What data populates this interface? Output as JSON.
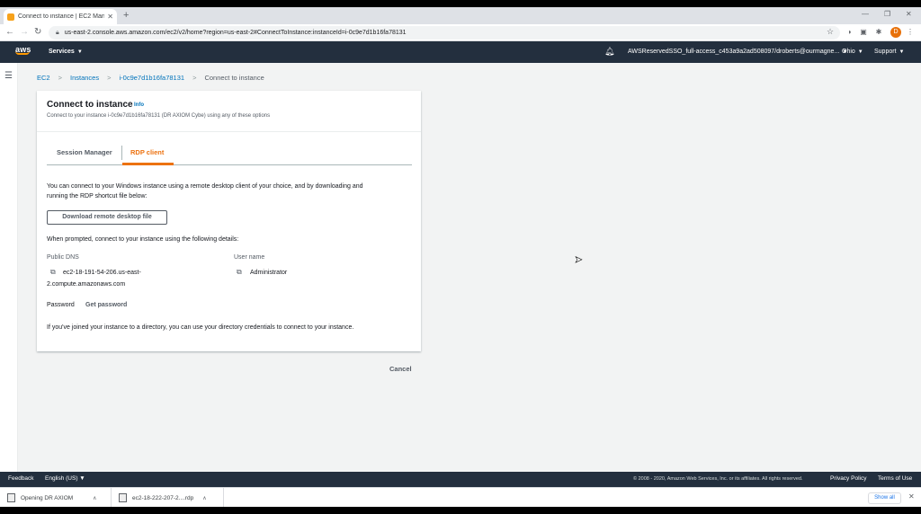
{
  "browser": {
    "tab_title": "Connect to instance | EC2 Manag...",
    "tab_close": "✕",
    "new_tab": "+",
    "url": "us-east-2.console.aws.amazon.com/ec2/v2/home?region=us-east-2#ConnectToInstance:instanceId=i-0c9e7d1b16fa78131",
    "profile_initial": "D",
    "win_min": "—",
    "win_max": "❐",
    "win_close": "✕"
  },
  "aws_nav": {
    "logo": "aws",
    "services": "Services",
    "account": "AWSReservedSSO_full-access_c453a9a2ad508097/droberts@ourmagne...",
    "region": "Ohio",
    "support": "Support"
  },
  "breadcrumb": {
    "ec2": "EC2",
    "instances": "Instances",
    "instance_id": "i-0c9e7d1b16fa78131",
    "current": "Connect to instance"
  },
  "panel": {
    "title": "Connect to instance",
    "info": "Info",
    "subtitle": "Connect to your instance i-0c9e7d1b16fa78131 (DR AXIOM Cybe) using any of these options",
    "tabs": [
      {
        "label": "Session Manager"
      },
      {
        "label": "RDP client"
      }
    ],
    "intro_line1": "You can connect to your Windows instance using a remote desktop client of your choice, and by downloading and",
    "intro_line2": "running the RDP shortcut file below:",
    "download_button": "Download remote desktop file",
    "prompt_text": "When prompted, connect to your instance using the following details:",
    "public_dns_label": "Public DNS",
    "public_dns_line1": "ec2-18-191-54-206.us-east-",
    "public_dns_line2": "2.compute.amazonaws.com",
    "username_label": "User name",
    "username_value": "Administrator",
    "password_label": "Password",
    "get_password": "Get password",
    "directory_note": "If you've joined your instance to a directory, you can use your directory credentials to connect to your instance."
  },
  "cancel_label": "Cancel",
  "footer": {
    "feedback": "Feedback",
    "language": "English (US)",
    "copyright": "© 2008 - 2020, Amazon Web Services, Inc. or its affiliates. All rights reserved.",
    "privacy": "Privacy Policy",
    "terms": "Terms of Use"
  },
  "downloads": {
    "item1": "Opening DR AXIOM",
    "item2": "ec2-18-222-207-2....rdp",
    "show_all": "Show all"
  }
}
